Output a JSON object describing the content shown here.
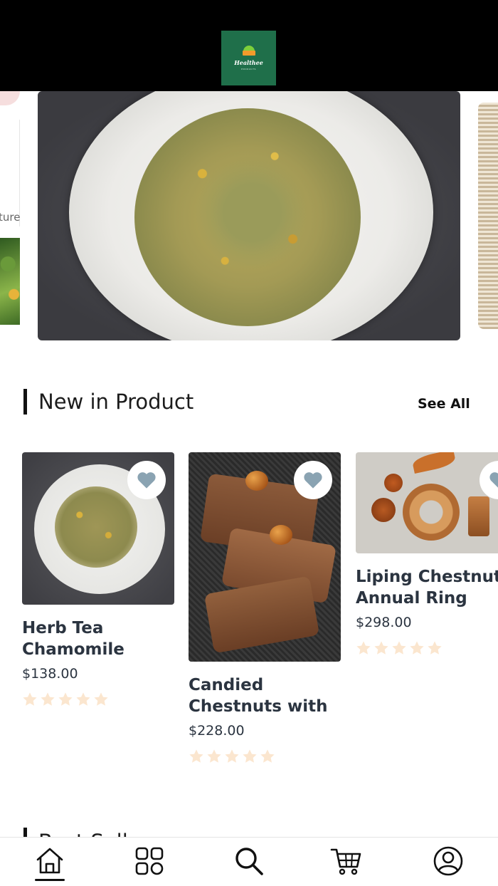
{
  "header": {
    "logo_text": "Healthee",
    "logo_tagline": "PRODUCTS"
  },
  "carousel": {
    "prev_caption": "ture"
  },
  "new_products": {
    "title": "New in Product",
    "see_all": "See All",
    "items": [
      {
        "name_line1": "Herb Tea",
        "name_line2": "Chamomile",
        "price": "$138.00",
        "rating": 0,
        "heart_icon": "heart-icon"
      },
      {
        "name_line1": "Candied",
        "name_line2": "Chestnuts with",
        "price": "$228.00",
        "rating": 0,
        "heart_icon": "heart-icon"
      },
      {
        "name_line1": "Liping Chestnut",
        "name_line2": "Annual Ring",
        "price": "$298.00",
        "rating": 0,
        "heart_icon": "heart-icon"
      }
    ]
  },
  "best_sellers": {
    "title": "Best Sellers"
  },
  "bottom_nav": {
    "items": [
      "home-icon",
      "categories-icon",
      "search-icon",
      "cart-icon",
      "profile-icon"
    ],
    "active": "home-icon"
  },
  "colors": {
    "header_bg": "#000000",
    "logo_bg": "#1f6f4a",
    "text_dark": "#2b3440",
    "heart": "#8aa3b2",
    "star_empty": "#fbe6cf"
  }
}
